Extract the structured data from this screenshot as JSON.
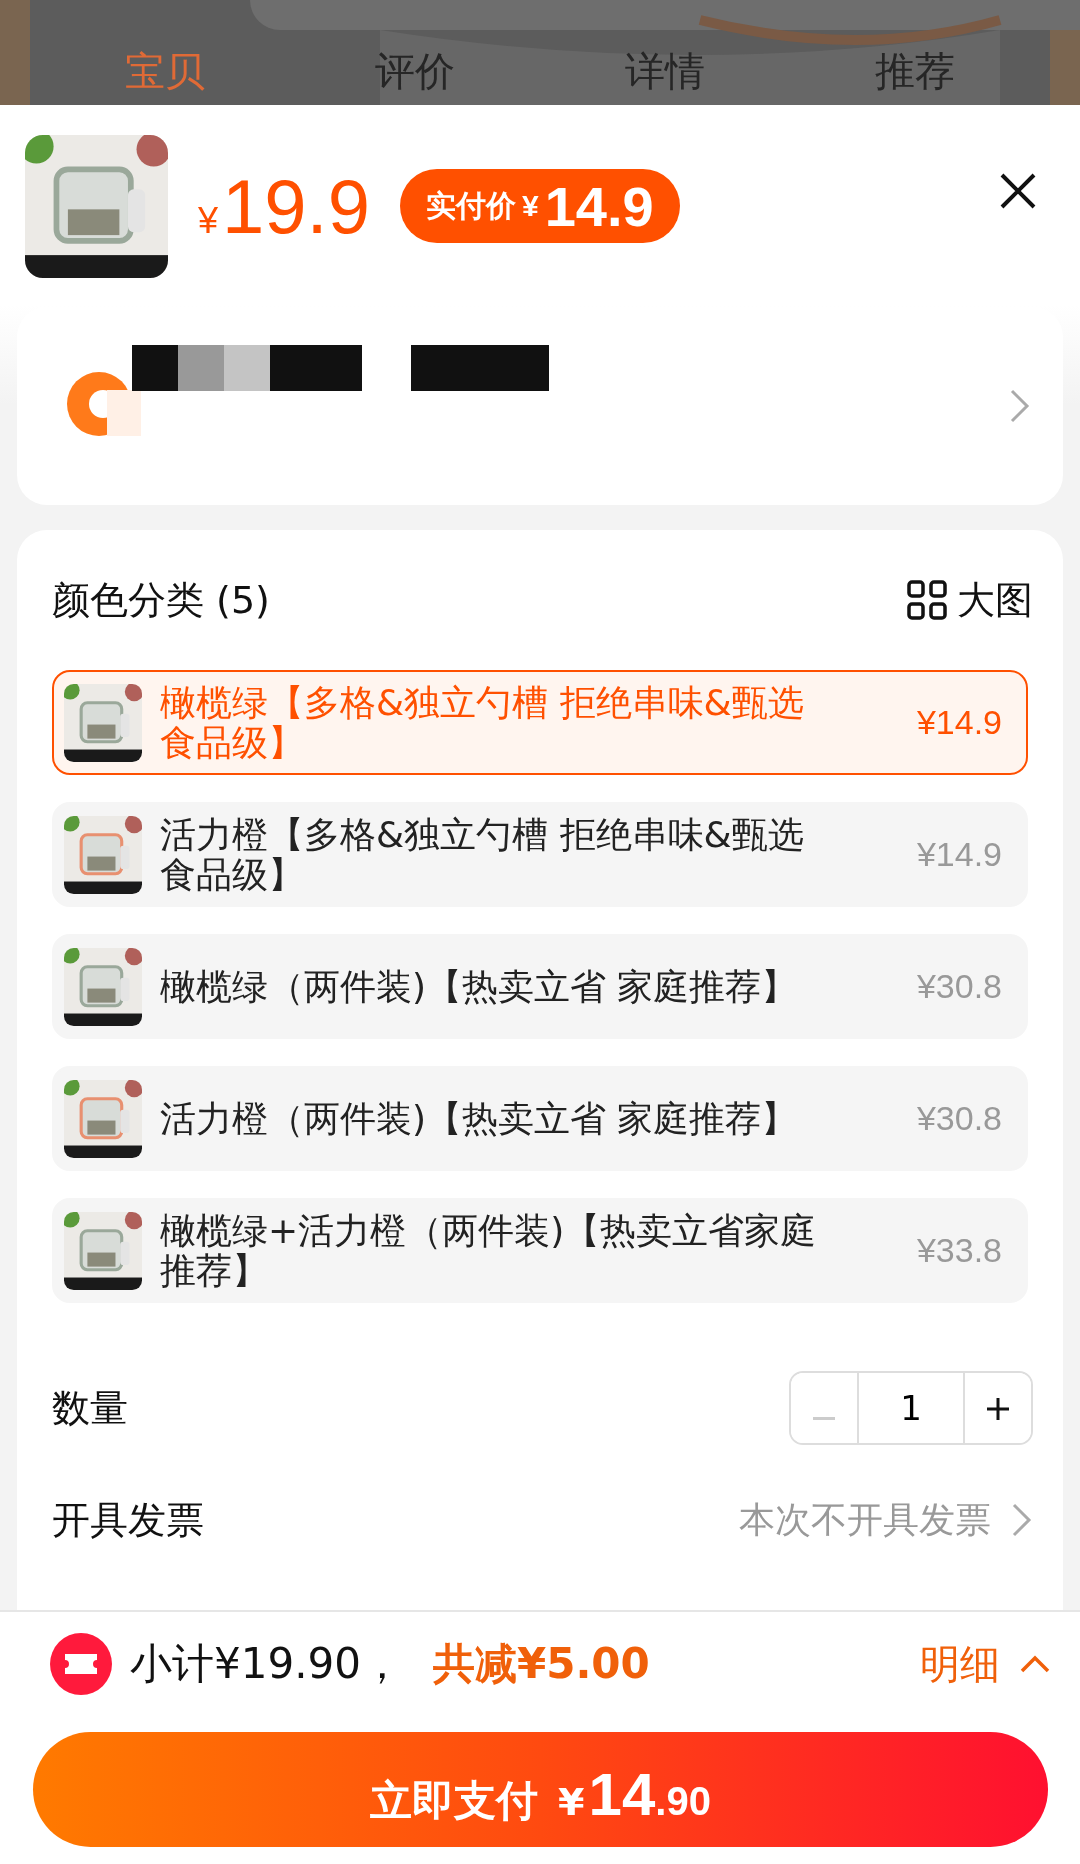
{
  "top_tabs": [
    {
      "label": "宝贝",
      "selected": true
    },
    {
      "label": "评价",
      "selected": false
    },
    {
      "label": "详情",
      "selected": false
    },
    {
      "label": "推荐",
      "selected": false
    }
  ],
  "header": {
    "price_symbol": "¥",
    "price": "19.9",
    "badge_label": "实付价",
    "badge_symbol": "¥",
    "badge_price": "14.9"
  },
  "address": {
    "redacted": true
  },
  "options": {
    "title": "颜色分类",
    "count": "(5)",
    "view_label": "大图",
    "items": [
      {
        "name": "橄榄绿【多格&独立勺槽 拒绝串味&甄选食品级】",
        "price": "¥14.9",
        "selected": true
      },
      {
        "name": "活力橙【多格&独立勺槽 拒绝串味&甄选食品级】",
        "price": "¥14.9",
        "selected": false
      },
      {
        "name": "橄榄绿（两件装)【热卖立省 家庭推荐】",
        "price": "¥30.8",
        "selected": false
      },
      {
        "name": "活力橙（两件装)【热卖立省 家庭推荐】",
        "price": "¥30.8",
        "selected": false
      },
      {
        "name": "橄榄绿+活力橙（两件装)【热卖立省家庭推荐】",
        "price": "¥33.8",
        "selected": false
      }
    ]
  },
  "quantity": {
    "label": "数量",
    "value": "1",
    "decrease_disabled": true
  },
  "invoice": {
    "label": "开具发票",
    "value": "本次不开具发票"
  },
  "summary": {
    "subtotal": "小计¥19.90，",
    "discount": "共减¥5.00",
    "detail": "明细"
  },
  "pay_button": {
    "label": "立即支付",
    "symbol": "¥",
    "amount_int": "14",
    "amount_dec": ".90"
  }
}
